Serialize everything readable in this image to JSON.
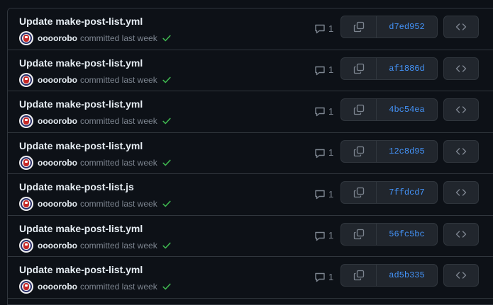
{
  "colors": {
    "background": "#0d1117",
    "border": "#30363d",
    "text_primary": "#e6edf3",
    "text_muted": "#7d8590",
    "link": "#4493f8",
    "success": "#3fb950",
    "button_bg": "#21262d"
  },
  "commits": [
    {
      "message": "Update make-post-list.yml",
      "author": "oooorobo",
      "action": "committed last week",
      "comments": "1",
      "sha": "d7ed952"
    },
    {
      "message": "Update make-post-list.yml",
      "author": "oooorobo",
      "action": "committed last week",
      "comments": "1",
      "sha": "af1886d"
    },
    {
      "message": "Update make-post-list.yml",
      "author": "oooorobo",
      "action": "committed last week",
      "comments": "1",
      "sha": "4bc54ea"
    },
    {
      "message": "Update make-post-list.yml",
      "author": "oooorobo",
      "action": "committed last week",
      "comments": "1",
      "sha": "12c8d95"
    },
    {
      "message": "Update make-post-list.js",
      "author": "oooorobo",
      "action": "committed last week",
      "comments": "1",
      "sha": "7ffdcd7"
    },
    {
      "message": "Update make-post-list.yml",
      "author": "oooorobo",
      "action": "committed last week",
      "comments": "1",
      "sha": "56fc5bc"
    },
    {
      "message": "Update make-post-list.yml",
      "author": "oooorobo",
      "action": "committed last week",
      "comments": "1",
      "sha": "ad5b335"
    }
  ],
  "icons": {
    "comment": "comment-icon",
    "copy": "copy-icon",
    "browse": "code-icon",
    "status": "check-icon"
  }
}
